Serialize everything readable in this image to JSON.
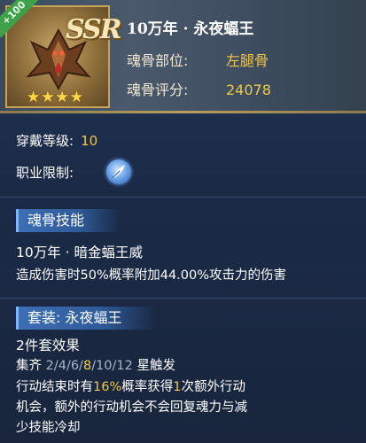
{
  "header": {
    "ribbon": "+100",
    "rarity": "SSR",
    "stars": "★★★★",
    "title": "10万年 · 永夜蝠王",
    "slot_label": "魂骨部位:",
    "slot_value": "左腿骨",
    "score_label": "魂骨评分:",
    "score_value": "24078"
  },
  "info": {
    "level_label": "穿戴等级:",
    "level_value": "10",
    "class_label": "职业限制:",
    "class_icon": "feather-class-icon"
  },
  "skill": {
    "tab": "魂骨技能",
    "name": "10万年 · 暗金蝠王威",
    "desc": "造成伤害时50%概率附加44.00%攻击力的伤害"
  },
  "set": {
    "tab": "套装: 永夜蝠王",
    "effect_title": "2件套效果",
    "collect_label": "集齐",
    "collect_a": "2/4/6/",
    "collect_b": "8",
    "collect_c": "/10/12",
    "trigger": "星触发",
    "desc1_a": "行动结束时有",
    "desc1_b": "16%",
    "desc1_c": "概率获得",
    "desc1_d": "1",
    "desc1_e": "次额外行动",
    "desc2": "机会，额外的行动机会不会回复魂力与减",
    "desc3": "少技能冷却"
  },
  "colors": {
    "gold": "#f0c846",
    "panel": "#1b2a45",
    "tab": "#3c6fb4"
  }
}
